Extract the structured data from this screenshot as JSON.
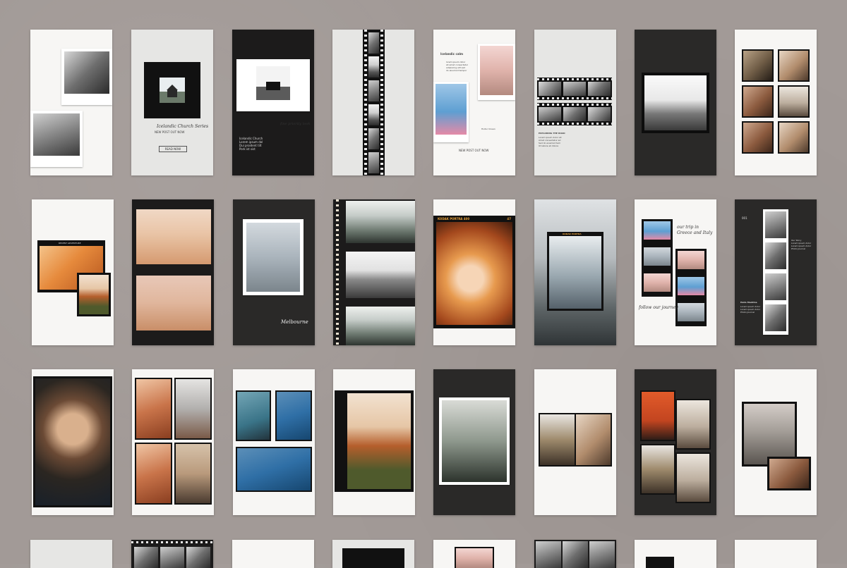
{
  "background_color": "#a29a97",
  "cards": {
    "r1c2": {
      "title": "Icelandic Church Series",
      "subtitle": "NEW POST OUT NOW",
      "button": "READ NOW"
    },
    "r1c3": {
      "script": "fine priority look",
      "text": "Icelandic Church\nLorem ipsum dol\nDui proident tilt\nPork ist sist"
    },
    "r1c5": {
      "heading": "Icelandic calm",
      "text": "lorem ipsum dolor\nsit amet consectetur\nadipiscing elit sed\ndo eiusmod tempor",
      "caption": "Hvitur Ocean",
      "footer": "NEW POST OUT NOW"
    },
    "r1c6": {
      "heading": "EXPLORING THE ROAD",
      "text": "Lorem ipsum dolor sit\nAmet consectetur ad\nSed do eiusmod tem\nUt labore et dolore"
    },
    "r2c1": {
      "label": "RECENT ADVENTURE"
    },
    "r2c3": {
      "script": "Melbourne"
    },
    "r2c5": {
      "film_label": "KODAK PORTRA 400",
      "film_number": "47"
    },
    "r2c6": {
      "label": "KODAK PORTRA"
    },
    "r2c7": {
      "script_top": "our trip in Greece and Italy",
      "script_bottom": "follow our journey"
    },
    "r2c8": {
      "number": "001",
      "text_top": "Our Story\nLorem ipsum dolor\nLorem ipsum dolor\nPhoto Journal",
      "heading_bottom": "Hello Madrina",
      "text_bottom": "Lorem ipsum dolor\nLorem ipsum dolor\nPhoto Journal"
    }
  }
}
